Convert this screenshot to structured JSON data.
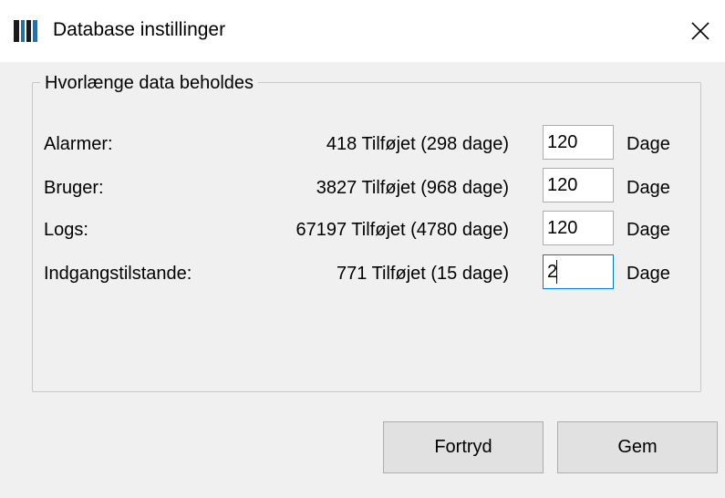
{
  "window": {
    "title": "Database instillinger",
    "close_glyph": "✕"
  },
  "group": {
    "legend": "Hvorlænge data beholdes"
  },
  "rows": [
    {
      "label": "Alarmer:",
      "info": "418 Tilføjet (298 dage)",
      "value": "120",
      "unit": "Dage"
    },
    {
      "label": "Bruger:",
      "info": "3827 Tilføjet (968 dage)",
      "value": "120",
      "unit": "Dage"
    },
    {
      "label": "Logs:",
      "info": "67197 Tilføjet (4780 dage)",
      "value": "120",
      "unit": "Dage"
    },
    {
      "label": "Indgangstilstande:",
      "info": "771 Tilføjet (15 dage)",
      "value": "2",
      "unit": "Dage"
    }
  ],
  "buttons": {
    "cancel_label": "Fortryd",
    "save_label": "Gem"
  },
  "icons": {
    "app": "database-app-icon",
    "close": "close-icon"
  }
}
